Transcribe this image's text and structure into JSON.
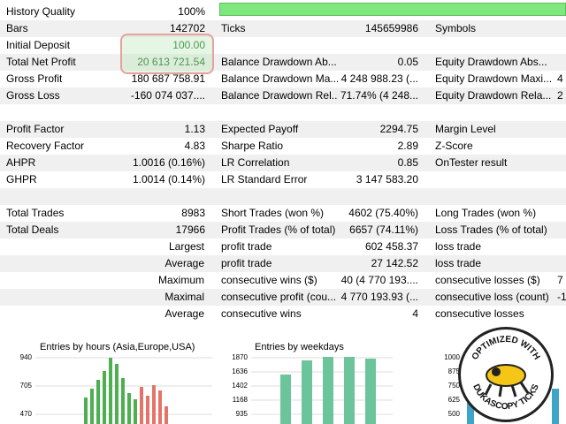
{
  "rows": [
    {
      "c1": "History Quality",
      "c2": "100%",
      "alt": false
    },
    {
      "c1": "Bars",
      "c2": "142702",
      "c3": "Ticks",
      "c4": "145659986",
      "c5": "Symbols",
      "alt": true
    },
    {
      "c1": "Initial Deposit",
      "c2": "100.00",
      "alt": false
    },
    {
      "c1": "Total Net Profit",
      "c2": "20 613 721.54",
      "c3": "Balance Drawdown Ab...",
      "c4": "0.05",
      "c5": "Equity Drawdown Abs...",
      "alt": true
    },
    {
      "c1": "Gross Profit",
      "c2": "180 687 758.91",
      "c3": "Balance Drawdown Ma...",
      "c4": "4 248 988.23 (...",
      "c5": "Equity Drawdown Maxi...",
      "c6": "4",
      "alt": false
    },
    {
      "c1": "Gross Loss",
      "c2": "-160 074 037....",
      "c3": "Balance Drawdown Rel...",
      "c4": "71.74% (4 248...",
      "c5": "Equity Drawdown Rela...",
      "c6": "2",
      "alt": true
    },
    {
      "alt": false
    },
    {
      "c1": "Profit Factor",
      "c2": "1.13",
      "c3": "Expected Payoff",
      "c4": "2294.75",
      "c5": "Margin Level",
      "alt": true
    },
    {
      "c1": "Recovery Factor",
      "c2": "4.83",
      "c3": "Sharpe Ratio",
      "c4": "2.89",
      "c5": "Z-Score",
      "alt": false
    },
    {
      "c1": "AHPR",
      "c2": "1.0016 (0.16%)",
      "c3": "LR Correlation",
      "c4": "0.85",
      "c5": "OnTester result",
      "alt": true
    },
    {
      "c1": "GHPR",
      "c2": "1.0014 (0.14%)",
      "c3": "LR Standard Error",
      "c4": "3 147 583.20",
      "alt": false
    },
    {
      "alt": true
    },
    {
      "c1": "Total Trades",
      "c2": "8983",
      "c3": "Short Trades (won %)",
      "c4": "4602 (75.40%)",
      "c5": "Long Trades (won %)",
      "alt": false
    },
    {
      "c1": "Total Deals",
      "c2": "17966",
      "c3": "Profit Trades (% of total)",
      "c4": "6657 (74.11%)",
      "c5": "Loss Trades (% of total)",
      "alt": true
    },
    {
      "c1r": "Largest",
      "c3": "profit trade",
      "c4": "602 458.37",
      "c5": "loss trade",
      "alt": false
    },
    {
      "c1r": "Average",
      "c3": "profit trade",
      "c4": "27 142.52",
      "c5": "loss trade",
      "alt": true
    },
    {
      "c1r": "Maximum",
      "c3": "consecutive wins ($)",
      "c4": "40 (4 770 193....",
      "c5": "consecutive losses ($)",
      "c6": "7",
      "alt": false
    },
    {
      "c1r": "Maximal",
      "c3": "consecutive profit (cou...",
      "c4": "4 770 193.93 (...",
      "c5": "consecutive loss (count)",
      "c6": "-1",
      "alt": true
    },
    {
      "c1r": "Average",
      "c3": "consecutive wins",
      "c4": "4",
      "c5": "consecutive losses",
      "alt": false
    }
  ],
  "history_quality_pct": 100,
  "charts": {
    "hours": {
      "title": "Entries by hours (Asia,Europe,USA)",
      "ticks": [
        "940",
        "705",
        "470"
      ]
    },
    "weekdays": {
      "title": "Entries by weekdays",
      "ticks": [
        "1870",
        "1636",
        "1402",
        "1168",
        "935"
      ]
    },
    "third": {
      "ticks": [
        "1000",
        "875",
        "750",
        "625",
        "500"
      ]
    }
  },
  "badge": {
    "top_text": "OPTIMIZED WITH",
    "bottom_text": "DUKASCOPY TICKS"
  },
  "colors": {
    "green_bar": "#4caf50",
    "red_bar": "#e57368",
    "teal_bar": "#6cc59a",
    "blue_bar": "#3ea4c8",
    "quality_bar": "#7ee87e"
  }
}
